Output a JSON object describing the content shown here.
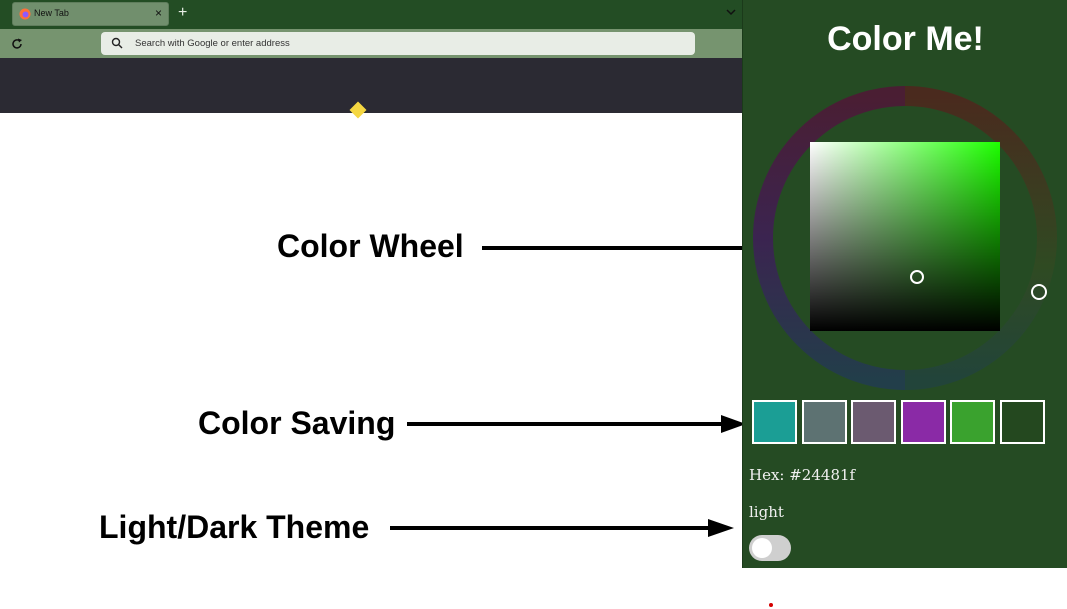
{
  "browser": {
    "tab_title": "New Tab",
    "tab_close": "×",
    "new_tab": "+",
    "url_placeholder": "Search with Google or enter address"
  },
  "annotations": {
    "color_wheel": "Color Wheel",
    "color_saving": "Color Saving",
    "theme": "Light/Dark Theme"
  },
  "popup": {
    "title": "Color Me!",
    "selected_color": "#24481f",
    "hex_label": "Hex: #24481f",
    "theme_label": "light",
    "theme_toggle_on": false,
    "saved_colors": [
      "#1b9e95",
      "#5d7272",
      "#6b5a70",
      "#8a2aa6",
      "#3aa22e",
      "#24481f"
    ]
  },
  "colors": {
    "panel_bg": "#254b23",
    "tabbar_bg": "#234d24",
    "navbar_bg": "#76946f",
    "hue_color": "#1dff00"
  }
}
